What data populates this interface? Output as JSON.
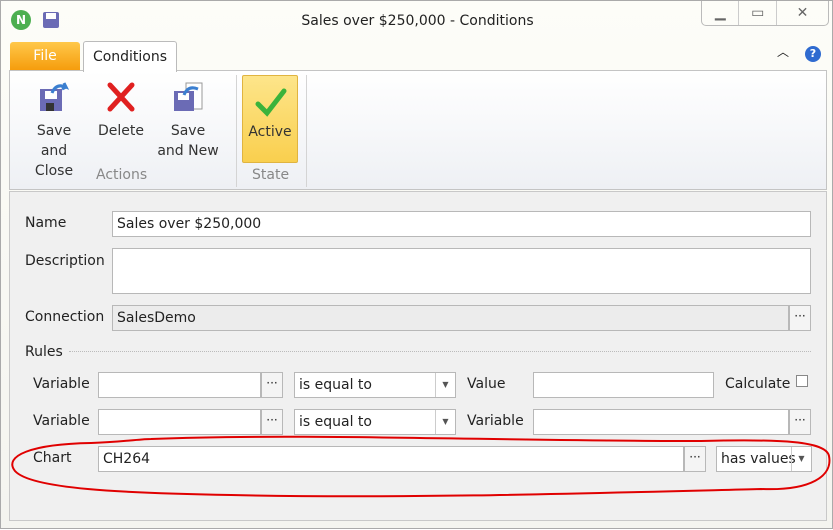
{
  "window": {
    "title": "Sales over $250,000 - Conditions",
    "logo": "N"
  },
  "tabs": {
    "file": "File",
    "conditions": "Conditions"
  },
  "ribbon": {
    "save_close": [
      "Save and",
      "Close"
    ],
    "delete": "Delete",
    "save_new": [
      "Save",
      "and New"
    ],
    "actions_group": "Actions",
    "active": "Active",
    "state_group": "State"
  },
  "form": {
    "name_label": "Name",
    "name_value": "Sales over $250,000",
    "description_label": "Description",
    "description_value": "",
    "connection_label": "Connection",
    "connection_value": "SalesDemo",
    "rules_label": "Rules",
    "row1": {
      "label": "Variable",
      "value": "",
      "operator": "is equal to",
      "value_label": "Value",
      "value_value": "",
      "calculate_label": "Calculate",
      "calculate_checked": false
    },
    "row2": {
      "label": "Variable",
      "value": "",
      "operator": "is equal to",
      "value_label": "Variable",
      "value_value": ""
    },
    "row3": {
      "label": "Chart",
      "value": "CH264",
      "operator": "has values"
    },
    "ellipsis": "···"
  },
  "annotation": {
    "color": "#e00000"
  }
}
